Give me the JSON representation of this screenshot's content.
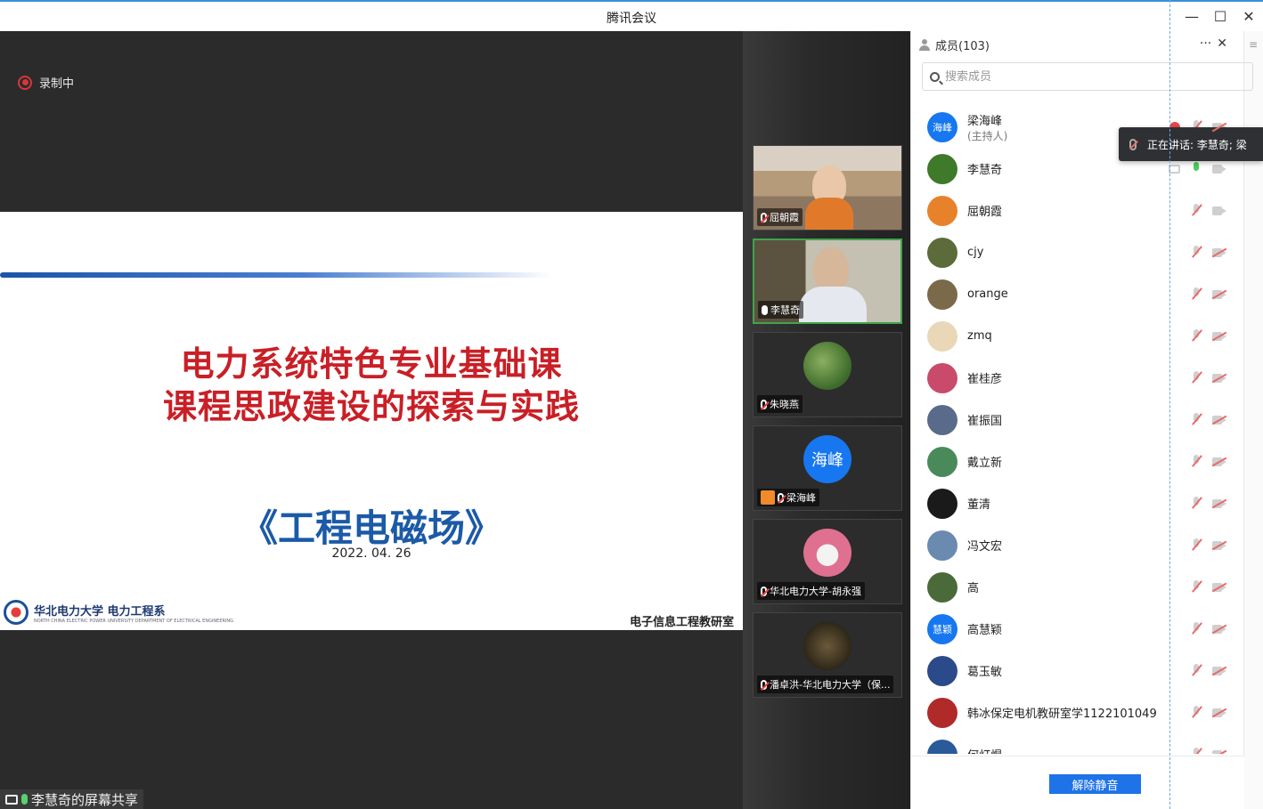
{
  "window": {
    "title": "腾讯会议",
    "controls": [
      "—",
      "☐",
      "✕"
    ]
  },
  "share": {
    "recording_label": "录制中",
    "slide": {
      "title_line1": "电力系统特色专业基础课",
      "title_line2": "课程思政建设的探索与实践",
      "book": "《工程电磁场》",
      "date": "2022. 04. 26",
      "logo_text": "华北电力大学 电力工程系",
      "logo_sub": "NORTH CHINA ELECTRIC POWER UNIVERSITY   DEPARTMENT OF ELECTRICAL ENGINEERING",
      "dept": "电子信息工程教研室"
    },
    "share_label": "李慧奇的屏幕共享"
  },
  "video_tiles": [
    {
      "name": "屈朝霞",
      "mic": "off"
    },
    {
      "name": "李慧奇",
      "mic": "on"
    },
    {
      "name": "朱晓燕",
      "mic": "off"
    },
    {
      "name": "梁海峰",
      "mic": "off",
      "avatar_text": "海峰",
      "host": true
    },
    {
      "name": "华北电力大学-胡永强",
      "mic": "off"
    },
    {
      "name": "潘卓洪-华北电力大学（保...",
      "mic": "off"
    }
  ],
  "members_panel": {
    "title": "成员(103)",
    "tools": {
      "more": "···",
      "close": "✕"
    },
    "side_menu": "≡",
    "search_placeholder": "搜索成员",
    "speaking_banner": "正在讲话: 李慧奇; 梁",
    "members": [
      {
        "name": "梁海峰",
        "role": "(主持人)",
        "avatar_text": "海峰",
        "avatar_color": "#1677f0"
      },
      {
        "name": "李慧奇",
        "role": "",
        "avatar_text": "",
        "avatar_color": "#3f7a2a"
      },
      {
        "name": "屈朝霞",
        "role": "",
        "avatar_text": "",
        "avatar_color": "#e8822a"
      },
      {
        "name": "cjy",
        "role": "",
        "avatar_text": "",
        "avatar_color": "#5b6b3a"
      },
      {
        "name": "orange",
        "role": "",
        "avatar_text": "",
        "avatar_color": "#7a6a4a"
      },
      {
        "name": "zmq",
        "role": "",
        "avatar_text": "",
        "avatar_color": "#e9d7b8"
      },
      {
        "name": "崔桂彦",
        "role": "",
        "avatar_text": "",
        "avatar_color": "#c94a6a"
      },
      {
        "name": "崔振国",
        "role": "",
        "avatar_text": "",
        "avatar_color": "#5a6a8a"
      },
      {
        "name": "戴立新",
        "role": "",
        "avatar_text": "",
        "avatar_color": "#4a8a5a"
      },
      {
        "name": "董清",
        "role": "",
        "avatar_text": "",
        "avatar_color": "#1a1a1a"
      },
      {
        "name": "冯文宏",
        "role": "",
        "avatar_text": "",
        "avatar_color": "#6a8ab0"
      },
      {
        "name": "高",
        "role": "",
        "avatar_text": "",
        "avatar_color": "#4a6a3a"
      },
      {
        "name": "高慧颖",
        "role": "",
        "avatar_text": "慧颖",
        "avatar_color": "#1677f0"
      },
      {
        "name": "葛玉敏",
        "role": "",
        "avatar_text": "",
        "avatar_color": "#2a4a8a"
      },
      {
        "name": "韩冰保定电机教研室学1122101049",
        "role": "",
        "avatar_text": "",
        "avatar_color": "#b02a2a"
      },
      {
        "name": "何灯煜",
        "role": "",
        "avatar_text": "",
        "avatar_color": "#2a5a9a"
      }
    ],
    "unmute_all_label": "解除静音"
  }
}
